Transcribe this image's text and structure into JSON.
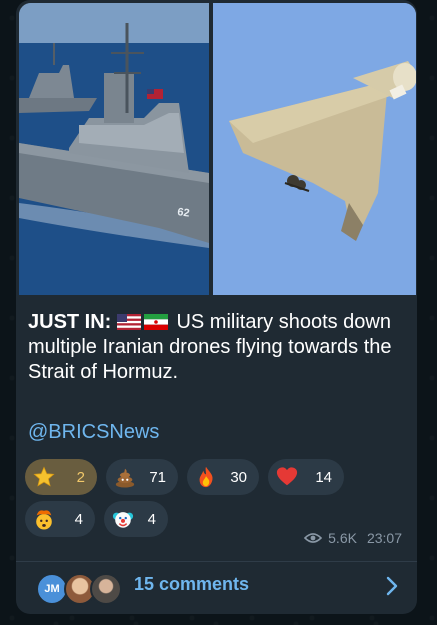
{
  "post": {
    "prefix": "JUST IN:",
    "body": "US military shoots down multiple Iranian drones flying towards the Strait of Hormuz.",
    "handle": "@BRICSNews",
    "flags": [
      "us-flag-icon",
      "iran-flag-icon"
    ]
  },
  "media": {
    "left_image": "warship-photo",
    "right_image": "drone-photo",
    "ship_hull_number": "62"
  },
  "reactions": [
    {
      "emoji": "star-icon",
      "count": "2",
      "selected": true
    },
    {
      "emoji": "poop-icon",
      "count": "71"
    },
    {
      "emoji": "fire-icon",
      "count": "30"
    },
    {
      "emoji": "heart-icon",
      "count": "14"
    },
    {
      "emoji": "exploding-head-icon",
      "count": "4"
    },
    {
      "emoji": "clown-icon",
      "count": "4"
    }
  ],
  "meta": {
    "views": "5.6K",
    "time": "23:07"
  },
  "comments": {
    "label": "15 comments",
    "first_avatar_initials": "JM"
  },
  "colors": {
    "card_bg": "#1f2a33",
    "link": "#6fb6ee",
    "selected_reaction": "#695d3f"
  }
}
